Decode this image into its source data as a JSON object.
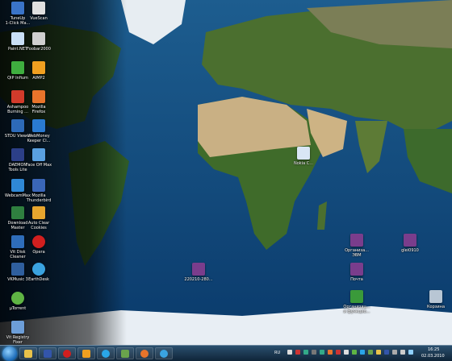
{
  "desktop": {
    "icons": [
      {
        "label": "TuneUp\n1-Click Ma...",
        "icon": "tuneup-icon",
        "color": "#3a74c8"
      },
      {
        "label": "VueScan",
        "icon": "vuescan-icon",
        "color": "#e0e0e0"
      },
      {
        "label": "Paint.NET",
        "icon": "paintnet-icon",
        "color": "#c9dff5"
      },
      {
        "label": "Foobar2000",
        "icon": "foobar-icon",
        "color": "#cfcfcf"
      },
      {
        "label": "QIP Infium",
        "icon": "qip-icon",
        "color": "#3fae3f"
      },
      {
        "label": "AIMP2",
        "icon": "aimp-icon",
        "color": "#f0a020"
      },
      {
        "label": "Ashampoo\nBurning ...",
        "icon": "ashampoo-icon",
        "color": "#d23b2b"
      },
      {
        "label": "Mozilla\nFirefox",
        "icon": "firefox-icon",
        "color": "#e8742b"
      },
      {
        "label": "STDU Viewer",
        "icon": "stdu-icon",
        "color": "#2d6ab8"
      },
      {
        "label": "WebMoney\nKeeper Cl...",
        "icon": "webmoney-icon",
        "color": "#2a7ad1"
      },
      {
        "label": "DAEMON\nTools Lite",
        "icon": "daemon-icon",
        "color": "#2c3f88"
      },
      {
        "label": "Face Off Max",
        "icon": "faceoff-icon",
        "color": "#5aa0e0"
      },
      {
        "label": "WebcamMax",
        "icon": "webcammax-icon",
        "color": "#2f88d6"
      },
      {
        "label": "Mozilla\nThunderbird",
        "icon": "thunderbird-icon",
        "color": "#3a66b8"
      },
      {
        "label": "Download\nMaster",
        "icon": "download-master-icon",
        "color": "#2f7f3f"
      },
      {
        "label": "Auto Clear\nCookies",
        "icon": "cookies-icon",
        "color": "#e7a52e"
      },
      {
        "label": "Vit Disk\nCleaner",
        "icon": "diskcleaner-icon",
        "color": "#2e6dba"
      },
      {
        "label": "Opera",
        "icon": "opera-icon",
        "color": "#d11f1f"
      },
      {
        "label": "VKMusic 3",
        "icon": "vkmusic-icon",
        "color": "#2f5f9e"
      },
      {
        "label": "EarthDesk",
        "icon": "earthdesk-icon",
        "color": "#3aa3e0"
      },
      {
        "label": "µTorrent",
        "icon": "utorrent-icon",
        "color": "#5fb444"
      },
      {
        "label": "Vit Registry\nFixer",
        "icon": "registry-icon",
        "color": "#6d9ed8"
      },
      {
        "label": "Nokia C...",
        "icon": "document-icon",
        "color": "#d9e6f5"
      },
      {
        "label": "220210-280...",
        "icon": "archive-icon",
        "color": "#7a3d8c"
      },
      {
        "label": "Организа...\nЭВМ",
        "icon": "archive-icon",
        "color": "#7a3d8c"
      },
      {
        "label": "glei0910",
        "icon": "archive-icon",
        "color": "#7a3d8c"
      },
      {
        "label": "Почта",
        "icon": "archive-icon",
        "color": "#7a3d8c"
      },
      {
        "label": "Организац...\nи функцио...",
        "icon": "document-icon",
        "color": "#3a9a3a"
      },
      {
        "label": "Корзина",
        "icon": "recycle-bin-icon",
        "color": "#b8c6d4"
      }
    ]
  },
  "taskbar": {
    "buttons": [
      {
        "icon": "explorer-icon",
        "color": "#e9c24a"
      },
      {
        "icon": "save-icon",
        "color": "#3355aa"
      },
      {
        "icon": "opera-icon",
        "color": "#d11f1f"
      },
      {
        "icon": "aimp-icon",
        "color": "#f0a020"
      },
      {
        "icon": "skype-icon",
        "color": "#2aa6e8"
      },
      {
        "icon": "app-icon",
        "color": "#6aa34c"
      },
      {
        "icon": "firefox-icon",
        "color": "#e8742b"
      },
      {
        "icon": "earthdesk-icon",
        "color": "#3aa3e0"
      }
    ],
    "language": "RU",
    "time": "16:25",
    "date": "02.03.2010"
  },
  "colors": {
    "ocean": "#0b3a6e",
    "land_green": "#3f6b2a",
    "desert": "#c9b084",
    "ice": "#e8eef4"
  }
}
